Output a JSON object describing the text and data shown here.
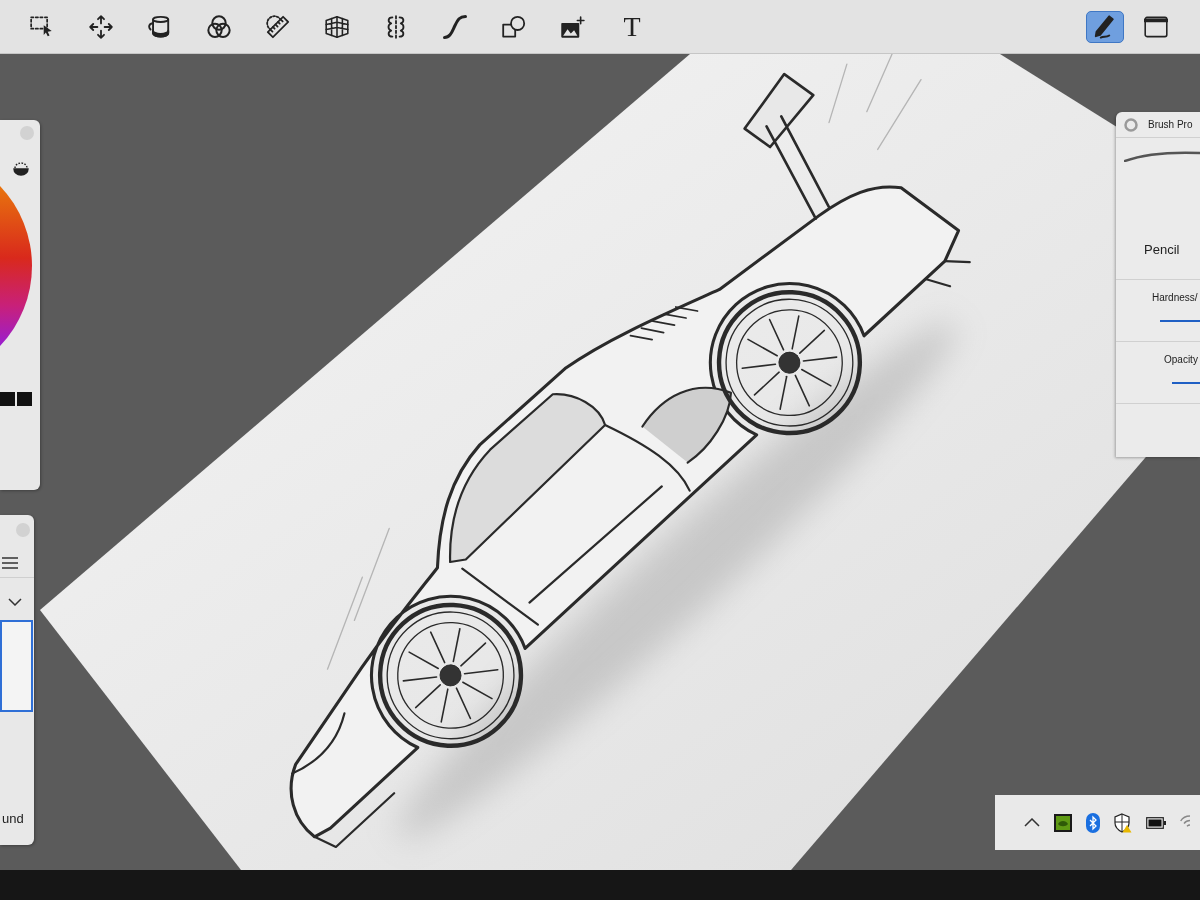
{
  "toolbar": {
    "tools": [
      {
        "kind": "select",
        "selected": false
      },
      {
        "kind": "move",
        "selected": false
      },
      {
        "kind": "fill",
        "selected": false
      },
      {
        "kind": "color_blend",
        "selected": false
      },
      {
        "kind": "ruler",
        "selected": false
      },
      {
        "kind": "perspective",
        "selected": false
      },
      {
        "kind": "symmetry",
        "selected": false
      },
      {
        "kind": "stroke",
        "selected": false
      },
      {
        "kind": "shapes",
        "selected": false
      },
      {
        "kind": "image",
        "selected": false
      },
      {
        "kind": "text",
        "label": "T",
        "selected": false
      }
    ],
    "view_tools": [
      {
        "kind": "pen",
        "selected": true
      },
      {
        "kind": "window",
        "selected": false
      }
    ]
  },
  "layers_panel": {
    "layers": [
      {
        "selected": true
      },
      {
        "name": "und",
        "selected": false
      }
    ]
  },
  "brush_panel": {
    "title": "Brush Pro",
    "brush": "Pencil",
    "settings": [
      {
        "label": "Hardness/",
        "level": 1
      },
      {
        "label": "Opacity",
        "level": 1
      }
    ]
  }
}
